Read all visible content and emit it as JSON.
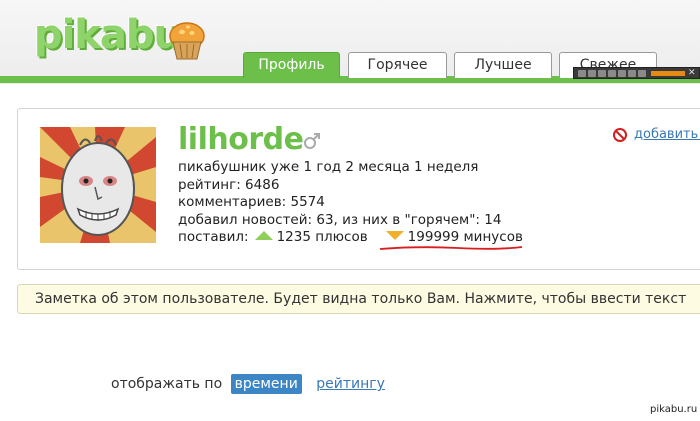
{
  "header": {
    "logo_text": "pikabu",
    "tabs": [
      {
        "label": "Профиль",
        "active": true
      },
      {
        "label": "Горячее",
        "active": false
      },
      {
        "label": "Лучшее",
        "active": false
      },
      {
        "label": "Свежее",
        "active": false
      }
    ]
  },
  "profile": {
    "username": "lilhorde",
    "gender_icon": "male-icon",
    "lines": {
      "age": "пикабушник уже 1 год 2 месяца 1 неделя",
      "rating": "рейтинг: 6486",
      "comments": "комментариев: 5574",
      "news": "добавил новостей: 63, из них в \"горячем\": 14",
      "voted_prefix": "поставил:",
      "pluses": "1235 плюсов",
      "minuses": "199999 минусов"
    },
    "add_link": "добавить в"
  },
  "note": {
    "text": "Заметка об этом пользователе. Будет видна только Вам. Нажмите, чтобы ввести текст"
  },
  "sort": {
    "prefix": "отображать по",
    "active": "времени",
    "link": "рейтингу"
  },
  "watermark": "pikabu.ru",
  "colors": {
    "brand_green": "#6cc04a",
    "link_blue": "#3a79b5",
    "up_arrow": "#8ecf5a",
    "down_arrow": "#f0b12a",
    "annotation_red": "#d81e1e"
  }
}
